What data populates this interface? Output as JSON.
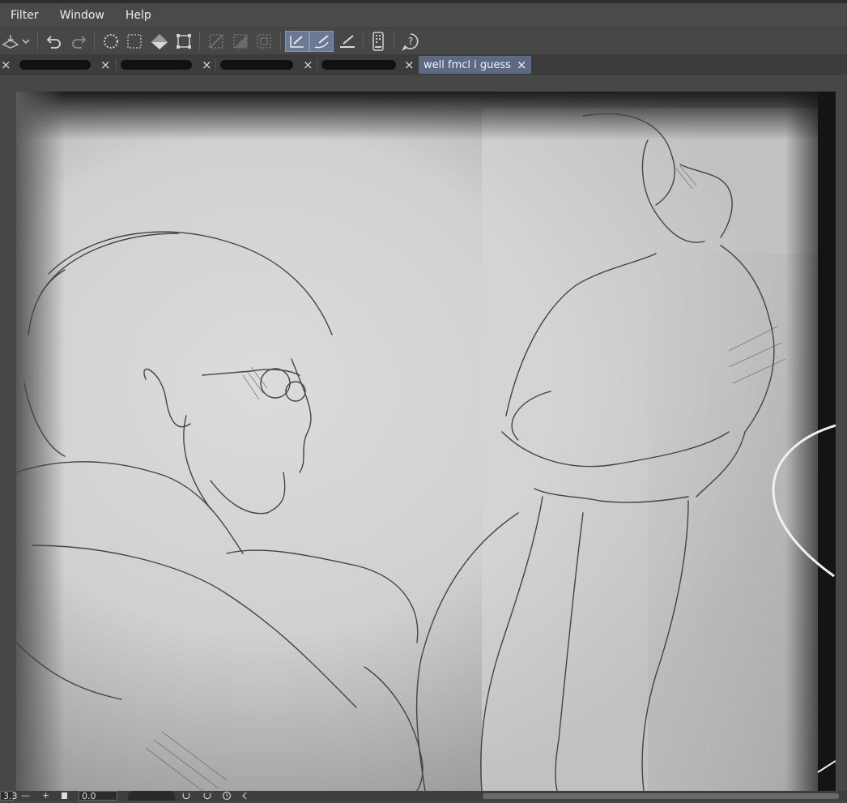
{
  "menubar": {
    "items": [
      "Filter",
      "Window",
      "Help"
    ]
  },
  "toolbar": {
    "icons": [
      "fill-layer-icon",
      "chevron-down-icon",
      "undo-icon",
      "redo-icon",
      "clear-selection-icon",
      "select-all-icon",
      "fill-icon",
      "transform-icon",
      "deselect-icon",
      "invert-selection-icon",
      "selection-border-icon",
      "pen-snap-icon",
      "brush-snap-icon",
      "ruler-snap-icon",
      "device-icon",
      "help-icon"
    ]
  },
  "tabs": {
    "items": [
      {
        "label": "",
        "redacted": true
      },
      {
        "label": "",
        "redacted": true
      },
      {
        "label": "",
        "redacted": true
      },
      {
        "label": "",
        "redacted": true
      },
      {
        "label": "well fmcl i guess",
        "redacted": false,
        "active": true
      }
    ],
    "close_glyph": "×"
  },
  "status": {
    "zoom": "3.3",
    "zoom_out": "—",
    "zoom_in": "+",
    "rotation": "0.0"
  },
  "colors": {
    "menubar": "#4a4a4a",
    "workspace": "#474747",
    "active_tab": "#5d6a86",
    "active_tool": "#6b7996"
  }
}
